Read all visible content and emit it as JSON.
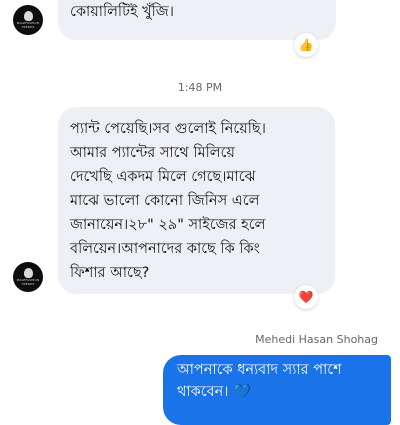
{
  "thread": {
    "contact_avatar_text": "MALEFASHION TRENDS",
    "messages": [
      {
        "direction": "incoming",
        "text": "কোয়ালিটিই খুঁজি।",
        "reaction": "👍"
      },
      {
        "direction": "incoming",
        "text": "প্যান্ট পেয়েছি।সব গুলোই নিয়েছি।\nআমার প্যান্টের সাথে মিলিয়ে\nদেখেছি একদম মিলে গেছে।মাঝে\nমাঝে ভালো কোনো জিনিস এলে\nজানায়েন।২৮\" ২৯\" সাইজের হলে\nবলিয়েন।আপনাদের কাছে কি কিং\nফিশার আছে?",
        "reaction": "❤️"
      },
      {
        "direction": "outgoing",
        "sender_name": "Mehedi Hasan Shohag",
        "text": "আপনাকে ধন্যবাদ স্যার পাশে\nথাকবেন।",
        "emoji": "💙"
      }
    ],
    "timestamp": "1:48 PM"
  }
}
